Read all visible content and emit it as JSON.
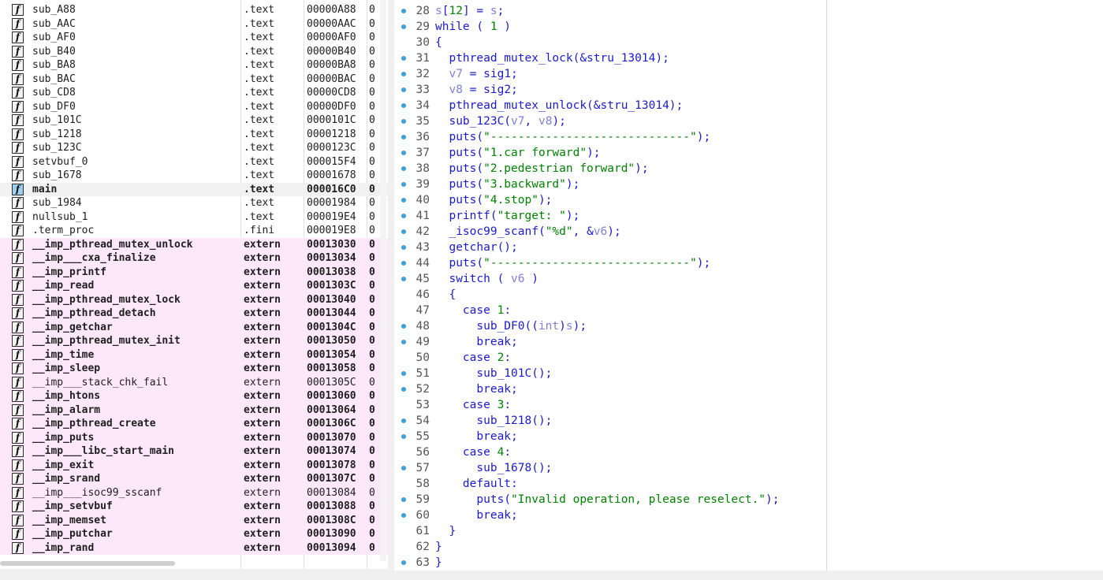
{
  "functions": [
    {
      "name": "sub_A88",
      "segment": ".text",
      "start": "00000A88",
      "cut": "0",
      "style": "normal"
    },
    {
      "name": "sub_AAC",
      "segment": ".text",
      "start": "00000AAC",
      "cut": "0",
      "style": "normal"
    },
    {
      "name": "sub_AF0",
      "segment": ".text",
      "start": "00000AF0",
      "cut": "0",
      "style": "normal"
    },
    {
      "name": "sub_B40",
      "segment": ".text",
      "start": "00000B40",
      "cut": "0",
      "style": "normal"
    },
    {
      "name": "sub_BA8",
      "segment": ".text",
      "start": "00000BA8",
      "cut": "0",
      "style": "normal"
    },
    {
      "name": "sub_BAC",
      "segment": ".text",
      "start": "00000BAC",
      "cut": "0",
      "style": "normal"
    },
    {
      "name": "sub_CD8",
      "segment": ".text",
      "start": "00000CD8",
      "cut": "0",
      "style": "normal"
    },
    {
      "name": "sub_DF0",
      "segment": ".text",
      "start": "00000DF0",
      "cut": "0",
      "style": "normal"
    },
    {
      "name": "sub_101C",
      "segment": ".text",
      "start": "0000101C",
      "cut": "0",
      "style": "normal"
    },
    {
      "name": "sub_1218",
      "segment": ".text",
      "start": "00001218",
      "cut": "0",
      "style": "normal"
    },
    {
      "name": "sub_123C",
      "segment": ".text",
      "start": "0000123C",
      "cut": "0",
      "style": "normal"
    },
    {
      "name": "setvbuf_0",
      "segment": ".text",
      "start": "000015F4",
      "cut": "0",
      "style": "normal"
    },
    {
      "name": "sub_1678",
      "segment": ".text",
      "start": "00001678",
      "cut": "0",
      "style": "normal"
    },
    {
      "name": "main",
      "segment": ".text",
      "start": "000016C0",
      "cut": "0",
      "style": "selected"
    },
    {
      "name": "sub_1984",
      "segment": ".text",
      "start": "00001984",
      "cut": "0",
      "style": "normal"
    },
    {
      "name": "nullsub_1",
      "segment": ".text",
      "start": "000019E4",
      "cut": "0",
      "style": "normal"
    },
    {
      "name": ".term_proc",
      "segment": ".fini",
      "start": "000019E8",
      "cut": "0",
      "style": "normal"
    },
    {
      "name": "__imp_pthread_mutex_unlock",
      "segment": "extern",
      "start": "00013030",
      "cut": "0",
      "style": "pink"
    },
    {
      "name": "__imp___cxa_finalize",
      "segment": "extern",
      "start": "00013034",
      "cut": "0",
      "style": "pink"
    },
    {
      "name": "__imp_printf",
      "segment": "extern",
      "start": "00013038",
      "cut": "0",
      "style": "pink"
    },
    {
      "name": "__imp_read",
      "segment": "extern",
      "start": "0001303C",
      "cut": "0",
      "style": "pink"
    },
    {
      "name": "__imp_pthread_mutex_lock",
      "segment": "extern",
      "start": "00013040",
      "cut": "0",
      "style": "pink"
    },
    {
      "name": "__imp_pthread_detach",
      "segment": "extern",
      "start": "00013044",
      "cut": "0",
      "style": "pink"
    },
    {
      "name": "__imp_getchar",
      "segment": "extern",
      "start": "0001304C",
      "cut": "0",
      "style": "pink"
    },
    {
      "name": "__imp_pthread_mutex_init",
      "segment": "extern",
      "start": "00013050",
      "cut": "0",
      "style": "pink"
    },
    {
      "name": "__imp_time",
      "segment": "extern",
      "start": "00013054",
      "cut": "0",
      "style": "pink"
    },
    {
      "name": "__imp_sleep",
      "segment": "extern",
      "start": "00013058",
      "cut": "0",
      "style": "pink"
    },
    {
      "name": "__imp___stack_chk_fail",
      "segment": "extern",
      "start": "0001305C",
      "cut": "0",
      "style": "pink-light"
    },
    {
      "name": "__imp_htons",
      "segment": "extern",
      "start": "00013060",
      "cut": "0",
      "style": "pink"
    },
    {
      "name": "__imp_alarm",
      "segment": "extern",
      "start": "00013064",
      "cut": "0",
      "style": "pink"
    },
    {
      "name": "__imp_pthread_create",
      "segment": "extern",
      "start": "0001306C",
      "cut": "0",
      "style": "pink"
    },
    {
      "name": "__imp_puts",
      "segment": "extern",
      "start": "00013070",
      "cut": "0",
      "style": "pink"
    },
    {
      "name": "__imp___libc_start_main",
      "segment": "extern",
      "start": "00013074",
      "cut": "0",
      "style": "pink"
    },
    {
      "name": "__imp_exit",
      "segment": "extern",
      "start": "00013078",
      "cut": "0",
      "style": "pink"
    },
    {
      "name": "__imp_srand",
      "segment": "extern",
      "start": "0001307C",
      "cut": "0",
      "style": "pink"
    },
    {
      "name": "__imp___isoc99_sscanf",
      "segment": "extern",
      "start": "00013084",
      "cut": "0",
      "style": "pink-light"
    },
    {
      "name": "__imp_setvbuf",
      "segment": "extern",
      "start": "00013088",
      "cut": "0",
      "style": "pink"
    },
    {
      "name": "__imp_memset",
      "segment": "extern",
      "start": "0001308C",
      "cut": "0",
      "style": "pink"
    },
    {
      "name": "__imp_putchar",
      "segment": "extern",
      "start": "00013090",
      "cut": "0",
      "style": "pink"
    },
    {
      "name": "__imp_rand",
      "segment": "extern",
      "start": "00013094",
      "cut": "0",
      "style": "pink"
    }
  ],
  "func_icon_glyph": "f",
  "code": {
    "top_partial": "",
    "lines": [
      {
        "n": "28",
        "dot": true,
        "text": "s[12] = s;"
      },
      {
        "n": "29",
        "dot": true,
        "text": "while ( 1 )"
      },
      {
        "n": "30",
        "dot": false,
        "text": "{"
      },
      {
        "n": "31",
        "dot": true,
        "text": "  pthread_mutex_lock(&stru_13014);"
      },
      {
        "n": "32",
        "dot": true,
        "text": "  v7 = sig1;"
      },
      {
        "n": "33",
        "dot": true,
        "text": "  v8 = sig2;"
      },
      {
        "n": "34",
        "dot": true,
        "text": "  pthread_mutex_unlock(&stru_13014);"
      },
      {
        "n": "35",
        "dot": true,
        "text": "  sub_123C(v7, v8);"
      },
      {
        "n": "36",
        "dot": true,
        "text": "  puts(\"-----------------------------\");"
      },
      {
        "n": "37",
        "dot": true,
        "text": "  puts(\"1.car forward\");"
      },
      {
        "n": "38",
        "dot": true,
        "text": "  puts(\"2.pedestrian forward\");"
      },
      {
        "n": "39",
        "dot": true,
        "text": "  puts(\"3.backward\");"
      },
      {
        "n": "40",
        "dot": true,
        "text": "  puts(\"4.stop\");"
      },
      {
        "n": "41",
        "dot": true,
        "text": "  printf(\"target: \");"
      },
      {
        "n": "42",
        "dot": true,
        "text": "  _isoc99_scanf(\"%d\", &v6);"
      },
      {
        "n": "43",
        "dot": true,
        "text": "  getchar();"
      },
      {
        "n": "44",
        "dot": true,
        "text": "  puts(\"-----------------------------\");"
      },
      {
        "n": "45",
        "dot": true,
        "text": "  switch ( v6 )"
      },
      {
        "n": "46",
        "dot": false,
        "text": "  {"
      },
      {
        "n": "47",
        "dot": false,
        "text": "    case 1:"
      },
      {
        "n": "48",
        "dot": true,
        "text": "      sub_DF0((int)s);"
      },
      {
        "n": "49",
        "dot": true,
        "text": "      break;"
      },
      {
        "n": "50",
        "dot": false,
        "text": "    case 2:"
      },
      {
        "n": "51",
        "dot": true,
        "text": "      sub_101C();"
      },
      {
        "n": "52",
        "dot": true,
        "text": "      break;"
      },
      {
        "n": "53",
        "dot": false,
        "text": "    case 3:"
      },
      {
        "n": "54",
        "dot": true,
        "text": "      sub_1218();"
      },
      {
        "n": "55",
        "dot": true,
        "text": "      break;"
      },
      {
        "n": "56",
        "dot": false,
        "text": "    case 4:"
      },
      {
        "n": "57",
        "dot": true,
        "text": "      sub_1678();"
      },
      {
        "n": "58",
        "dot": false,
        "text": "    default:"
      },
      {
        "n": "59",
        "dot": true,
        "text": "      puts(\"Invalid operation, please reselect.\");"
      },
      {
        "n": "60",
        "dot": true,
        "text": "      break;"
      },
      {
        "n": "61",
        "dot": false,
        "text": "  }"
      },
      {
        "n": "62",
        "dot": false,
        "text": "}"
      },
      {
        "n": "63",
        "dot": true,
        "text": "}"
      }
    ]
  },
  "status": {
    "left": "",
    "right": ""
  },
  "colors": {
    "keyword": "#1a1ad0",
    "variable": "#8080d8",
    "string": "#008000",
    "extern_row_bg": "#fde8fb",
    "selected_icon": "#9fd0f0",
    "line_dot": "#3aa0e8"
  }
}
